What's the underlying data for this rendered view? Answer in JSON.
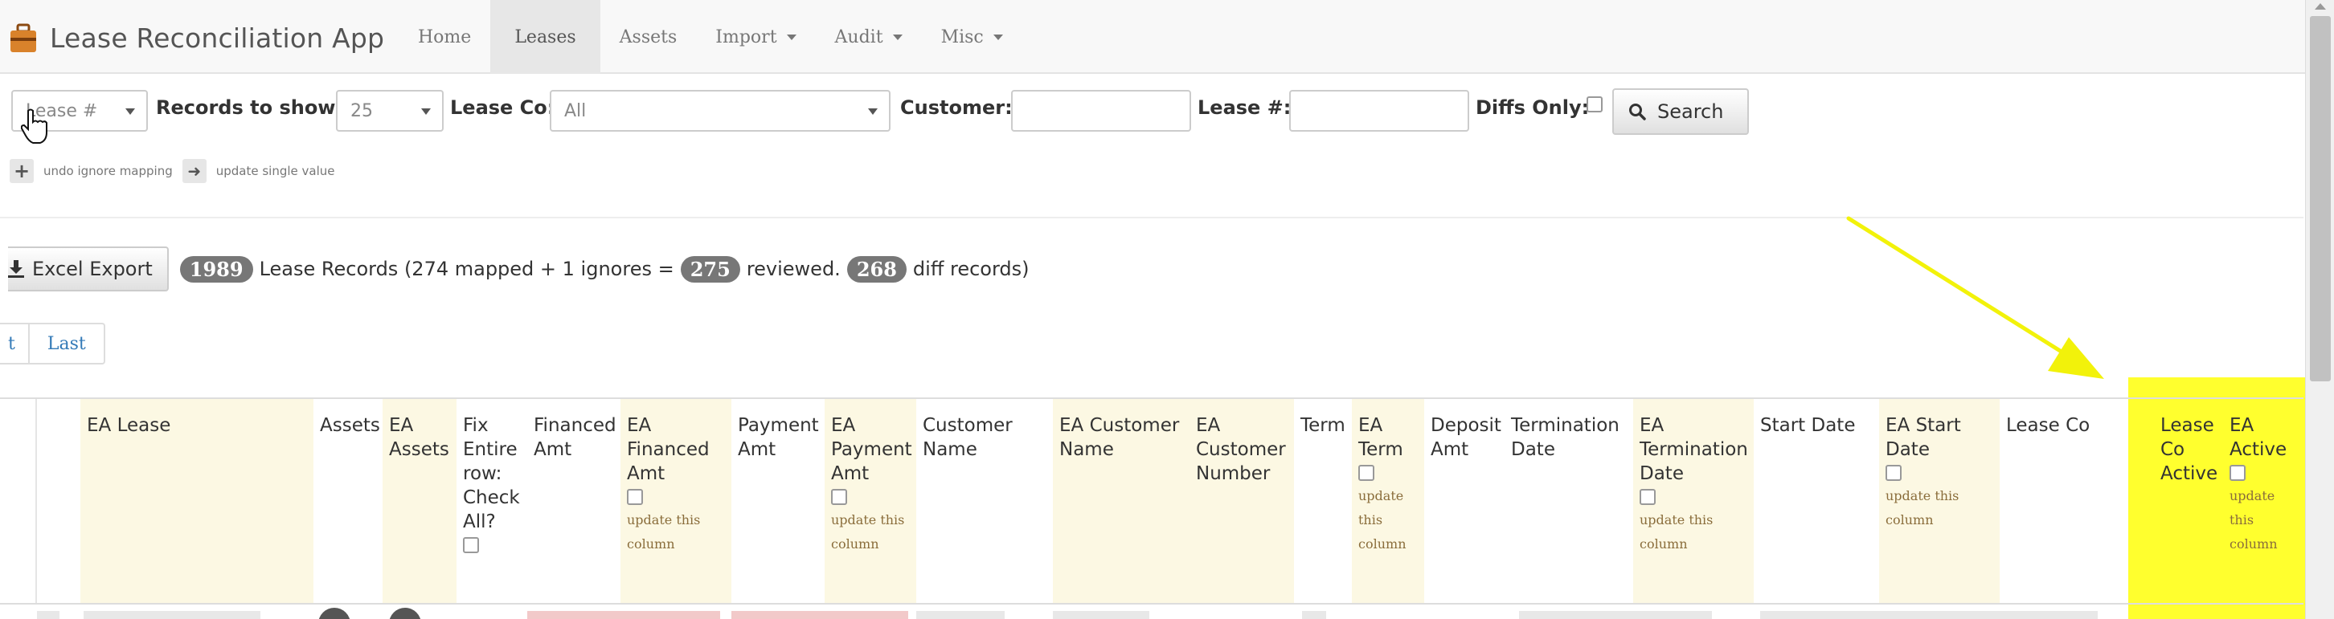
{
  "app": {
    "title": "Lease Reconciliation App"
  },
  "nav": {
    "items": [
      {
        "label": "Home",
        "active": false,
        "dropdown": false
      },
      {
        "label": "Leases",
        "active": true,
        "dropdown": false
      },
      {
        "label": "Assets",
        "active": false,
        "dropdown": false
      },
      {
        "label": "Import",
        "active": false,
        "dropdown": true
      },
      {
        "label": "Audit",
        "active": false,
        "dropdown": true
      },
      {
        "label": "Misc",
        "active": false,
        "dropdown": true
      }
    ]
  },
  "filters": {
    "sort_select": "Lease #",
    "records_label": "Records to show:",
    "records_value": "25",
    "lease_co_label": "Lease Co:",
    "lease_co_value": "All",
    "customer_label": "Customer:",
    "customer_value": "",
    "lease_no_label": "Lease #:",
    "lease_no_value": "",
    "diffs_only_label": "Diffs Only:",
    "search_label": "Search"
  },
  "hints": {
    "undo_label": "undo ignore mapping",
    "update_label": "update single value"
  },
  "summary": {
    "export_label": "Excel Export",
    "total": "1989",
    "text_mid": "Lease Records (274 mapped + 1 ignores =",
    "reviewed": "275",
    "reviewed_text": "reviewed.",
    "diffs": "268",
    "diffs_text": "diff records)"
  },
  "pager": {
    "next_label": "t",
    "last_label": "Last"
  },
  "table": {
    "update_column_label": "update this column",
    "headers": [
      {
        "label": "EA Lease",
        "ea": true
      },
      {
        "label": "Assets",
        "ea": false
      },
      {
        "label": "EA Assets",
        "ea": true
      },
      {
        "label": "Fix Entire row: Check All?",
        "ea": false
      },
      {
        "label": "Financed Amt",
        "ea": false
      },
      {
        "label": "EA Financed Amt",
        "ea": true
      },
      {
        "label": "Payment Amt",
        "ea": false
      },
      {
        "label": "EA Payment Amt",
        "ea": true
      },
      {
        "label": "Customer Name",
        "ea": false
      },
      {
        "label": "EA Customer Name",
        "ea": true
      },
      {
        "label": "EA Customer Number",
        "ea": true
      },
      {
        "label": "Term",
        "ea": false
      },
      {
        "label": "EA Term",
        "ea": true
      },
      {
        "label": "Deposit Amt",
        "ea": false
      },
      {
        "label": "Termination Date",
        "ea": false
      },
      {
        "label": "EA Termination Date",
        "ea": true
      },
      {
        "label": "Start Date",
        "ea": false
      },
      {
        "label": "EA Start Date",
        "ea": true
      },
      {
        "label": "Lease Co",
        "ea": false
      },
      {
        "label": "Lease Co Active",
        "ea": false
      },
      {
        "label": "EA Active",
        "ea": true
      }
    ]
  },
  "colors": {
    "highlight": "#ffff00",
    "arrow": "#f2f20a",
    "ea_column_bg": "#fcf8e3",
    "badge_bg": "#777777",
    "link": "#337ab7"
  }
}
